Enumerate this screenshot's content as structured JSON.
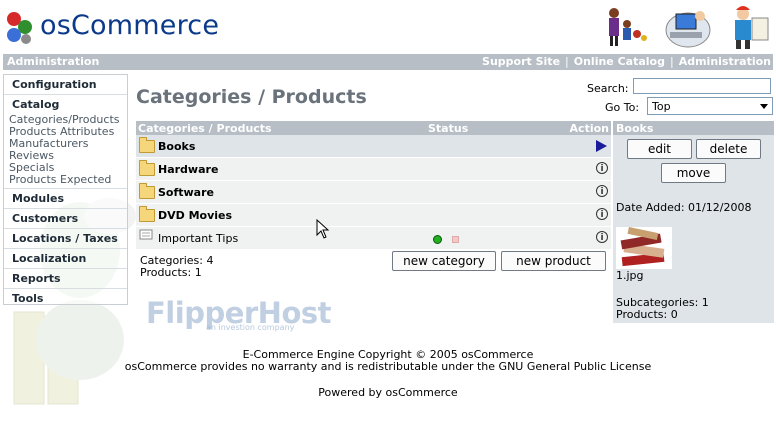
{
  "brand": {
    "logo": "osCommerce"
  },
  "topbar": {
    "left": "Administration",
    "links": [
      "Support Site",
      "Online Catalog",
      "Administration"
    ]
  },
  "menu": {
    "configuration": "Configuration",
    "catalog": "Catalog",
    "catalog_items": [
      "Categories/Products",
      "Products Attributes",
      "Manufacturers",
      "Reviews",
      "Specials",
      "Products Expected"
    ],
    "modules": "Modules",
    "customers": "Customers",
    "locations": "Locations / Taxes",
    "localization": "Localization",
    "reports": "Reports",
    "tools": "Tools"
  },
  "page": {
    "title": "Categories / Products",
    "search_label": "Search:",
    "search_value": "",
    "goto_label": "Go To:",
    "goto_value": "Top"
  },
  "table": {
    "columns": {
      "name": "Categories / Products",
      "status": "Status",
      "action": "Action"
    },
    "rows": [
      {
        "label": "Books",
        "type": "category",
        "selected": true
      },
      {
        "label": "Hardware",
        "type": "category"
      },
      {
        "label": "Software",
        "type": "category"
      },
      {
        "label": "DVD Movies",
        "type": "category"
      },
      {
        "label": "Important Tips",
        "type": "product",
        "status": "active"
      }
    ],
    "categories_count": "Categories: 4",
    "products_count": "Products: 1",
    "new_category": "new category",
    "new_product": "new product"
  },
  "panel": {
    "title": "Books",
    "edit": "edit",
    "delete": "delete",
    "move": "move",
    "date_added": "Date Added: 01/12/2008",
    "image_name": "1.jpg",
    "subcategories": "Subcategories: 1",
    "products": "Products: 0"
  },
  "watermark": {
    "text": "FlipperHost",
    "sub": "an investion company"
  },
  "footer": {
    "line1": "E-Commerce Engine Copyright © 2005 osCommerce",
    "line2": "osCommerce provides no warranty and is redistributable under the GNU General Public License",
    "powered": "Powered by osCommerce"
  },
  "colors": {
    "bar": "#b7bec6",
    "selected_row": "#dee4e8",
    "title": "#6a737c",
    "logo": "#0b3a8a"
  }
}
